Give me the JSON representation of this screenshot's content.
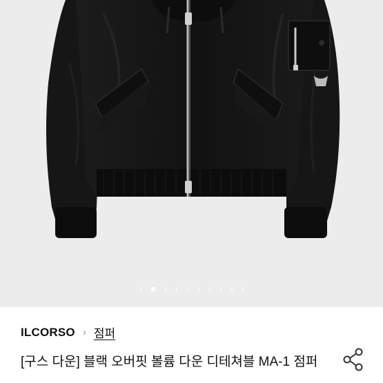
{
  "gallery": {
    "image_label": "black bomber jacket product photo",
    "slide_count": 10,
    "active_slide": 2
  },
  "product": {
    "brand": "ILCORSO",
    "breadcrumb_separator": "›",
    "category": "점퍼",
    "title": "[구스 다운] 블랙 오버핏 볼륨 다운 디테쳐블 MA-1 점퍼"
  },
  "icons": {
    "share": "share-icon",
    "chevron": "chevron-right-icon"
  },
  "colors": {
    "background": "#ffffff",
    "photo_backdrop": "#ececec",
    "jacket": "#141414",
    "text": "#111111",
    "muted": "#9a9a9a"
  }
}
